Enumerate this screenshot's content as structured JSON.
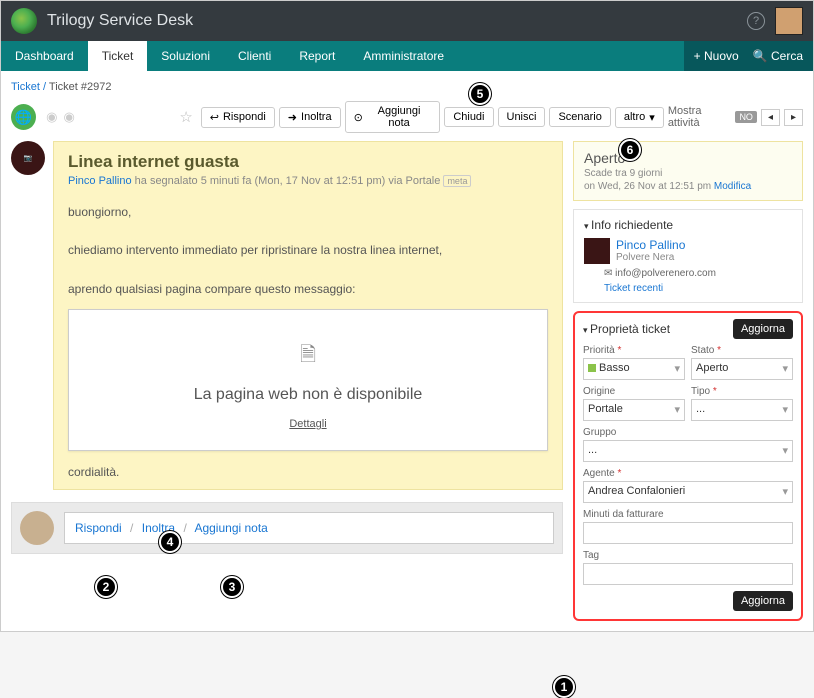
{
  "brand": "Trilogy Service Desk",
  "nav": {
    "items": [
      "Dashboard",
      "Ticket",
      "Soluzioni",
      "Clienti",
      "Report",
      "Amministratore"
    ],
    "active": "Ticket",
    "new": "+ Nuovo",
    "search": "Cerca",
    "search_icon": "🔍"
  },
  "crumbs": {
    "root": "Ticket",
    "current": "Ticket #2972"
  },
  "toolbar": {
    "rispondi": "Rispondi",
    "inoltra": "Inoltra",
    "aggiungi_nota": "Aggiungi nota",
    "chiudi": "Chiudi",
    "unisci": "Unisci",
    "scenario": "Scenario",
    "altro": "altro",
    "mostra": "Mostra attività",
    "switch": "NO",
    "arrow_reply": "↩",
    "arrow_fwd": "➜",
    "note_icon": "⊙",
    "dropdown_caret": "▾"
  },
  "ticket": {
    "title": "Linea internet guasta",
    "reporter": "Pinco Pallino",
    "meta_line": " ha segnalato 5 minuti fa (Mon, 17 Nov at 12:51 pm) via Portale ",
    "meta_tag": "meta",
    "msg1": "buongiorno,",
    "msg2": "chiediamo intervento immediato per ripristinare la nostra linea internet,",
    "msg3": "aprendo qualsiasi pagina compare questo messaggio:",
    "err_title": "La pagina web non è disponibile",
    "err_link": "Dettagli",
    "closing": "cordialità."
  },
  "bottom_actions": {
    "rispondi": "Rispondi",
    "inoltra": "Inoltra",
    "aggiungi_nota": "Aggiungi nota"
  },
  "status": {
    "title": "Aperto",
    "due_line": "Scade tra 9 giorni",
    "due_at": "on Wed, 26 Nov at 12:51 pm ",
    "modify": "Modifica"
  },
  "requester": {
    "section": "Info richiedente",
    "name": "Pinco Pallino",
    "company": "Polvere Nera",
    "email_icon": "✉",
    "email": "info@polverenero.com",
    "recent": "Ticket recenti"
  },
  "props": {
    "section": "Proprietà ticket",
    "update": "Aggiorna",
    "priority_label": "Priorità",
    "priority_value": "Basso",
    "state_label": "Stato",
    "state_value": "Aperto",
    "source_label": "Origine",
    "source_value": "Portale",
    "type_label": "Tipo",
    "type_value": "...",
    "group_label": "Gruppo",
    "group_value": "...",
    "agent_label": "Agente",
    "agent_value": "Andrea Confalonieri",
    "minutes_label": "Minuti da fatturare",
    "tag_label": "Tag"
  },
  "annotations": {
    "b1": "1",
    "b2": "2",
    "b3": "3",
    "b4": "4",
    "b5": "5",
    "b6": "6"
  }
}
